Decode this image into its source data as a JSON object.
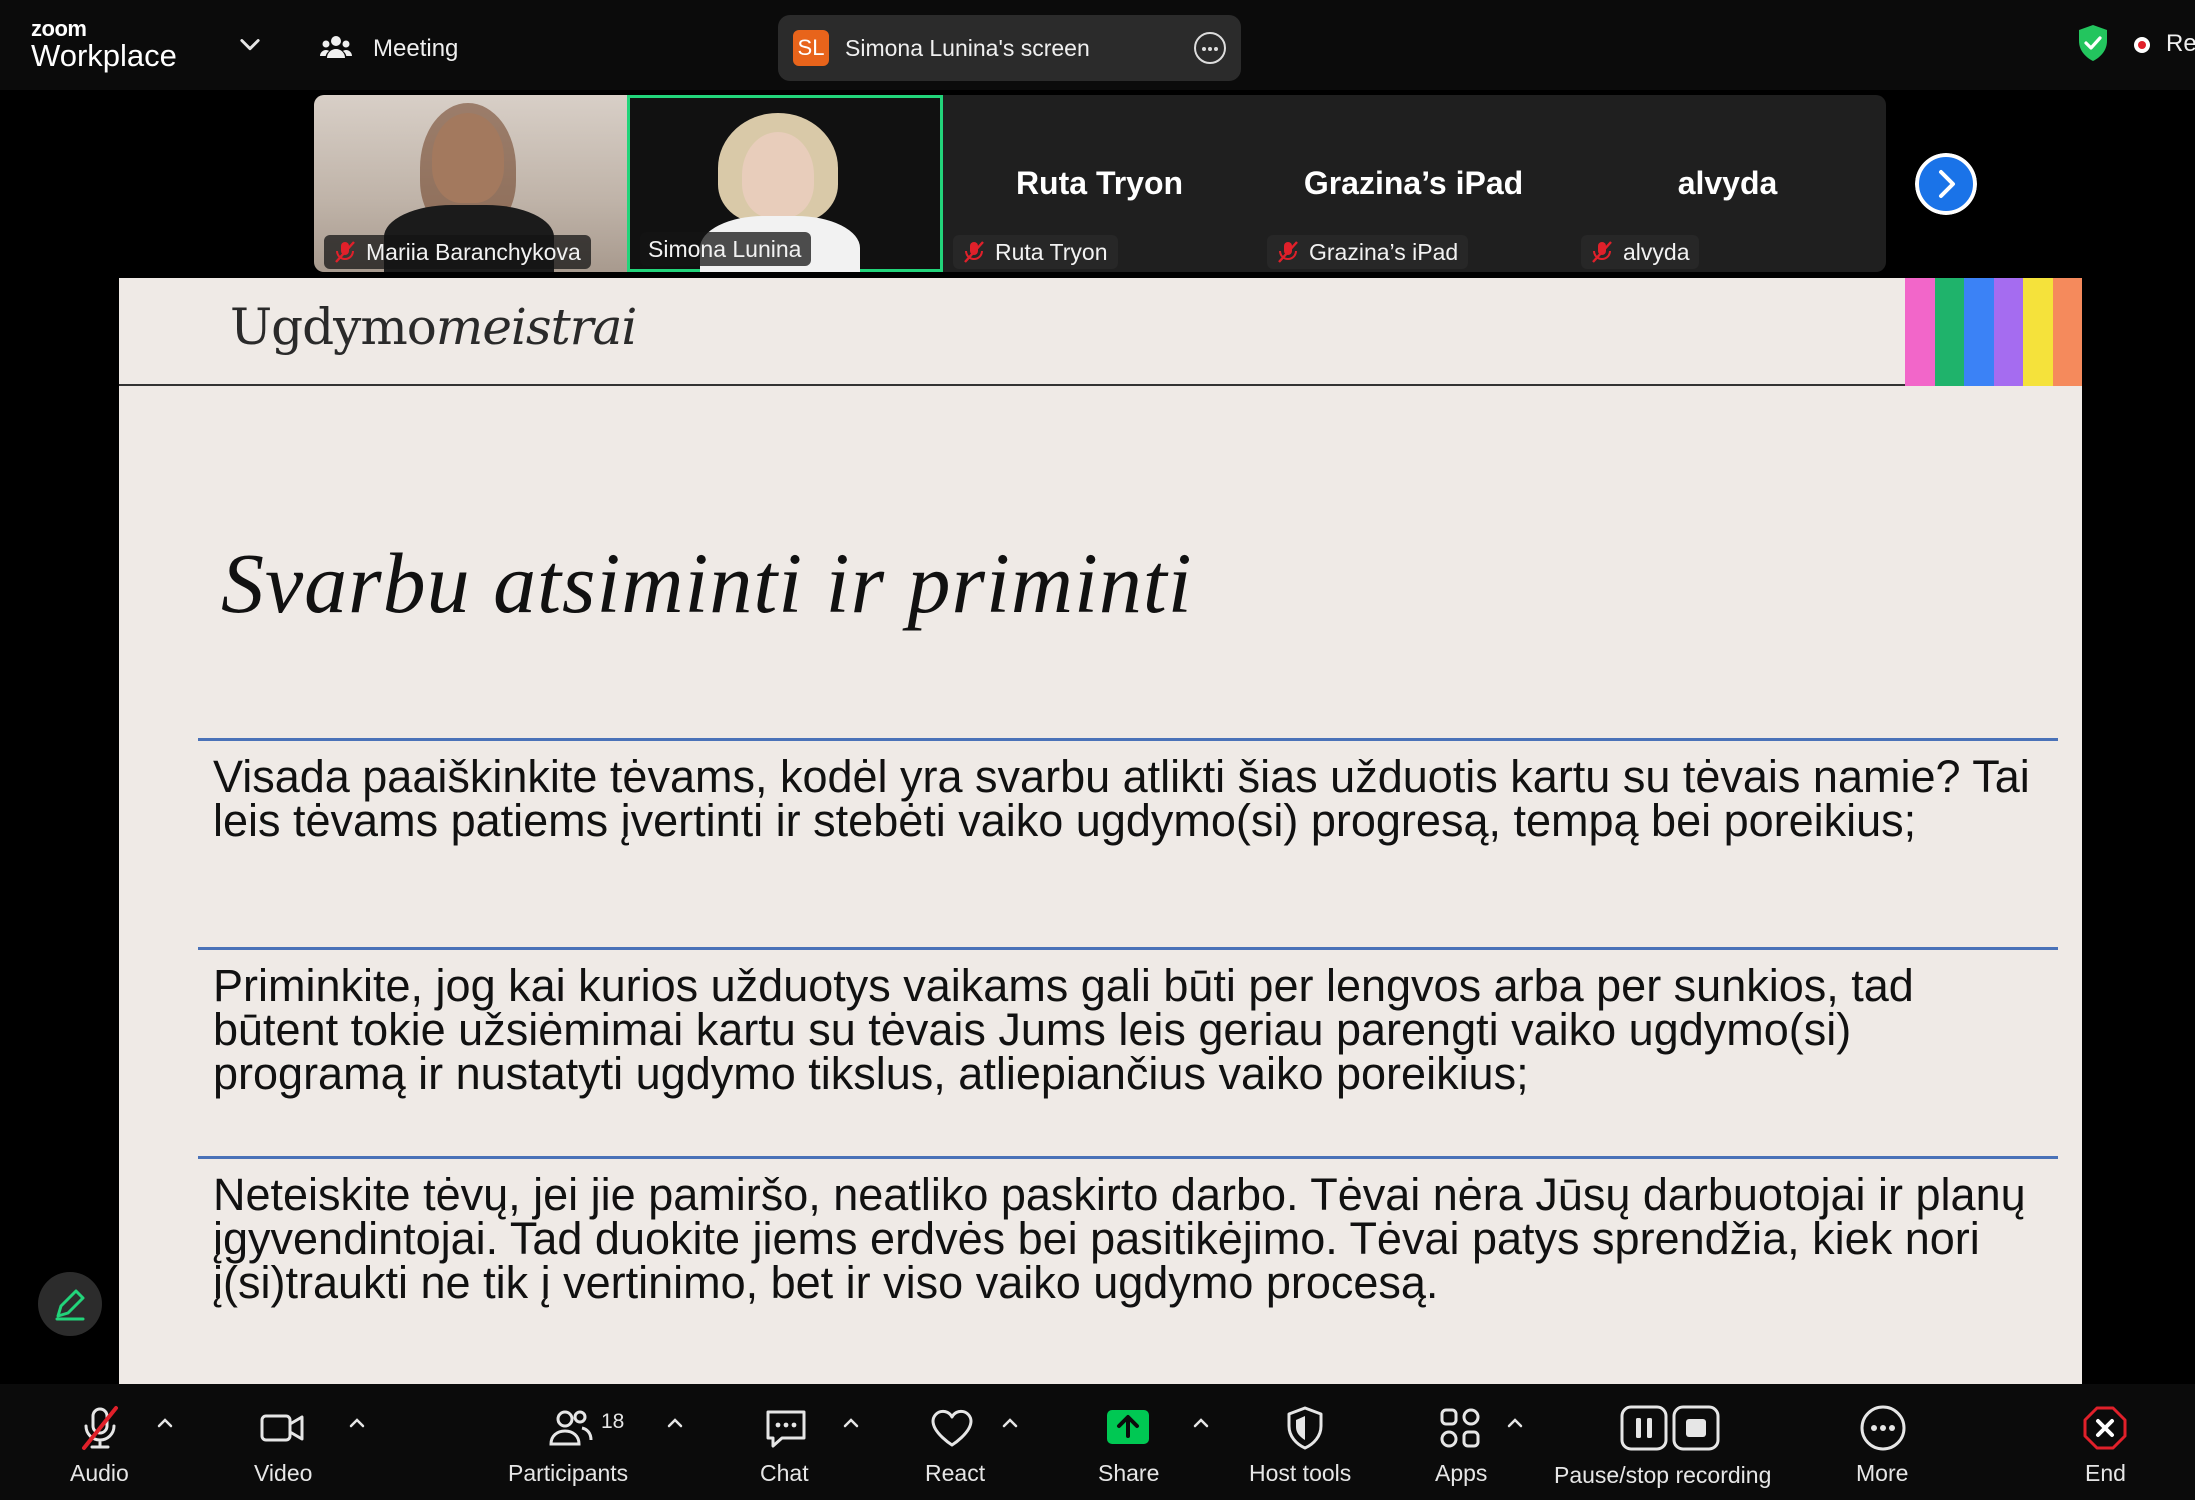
{
  "topbar": {
    "logo_small": "zoom",
    "logo_big": "Workplace",
    "meeting_label": "Meeting",
    "share_badge": "SL",
    "share_text": "Simona Lunina's screen",
    "recording_label": "Recording"
  },
  "gallery": {
    "tiles": [
      {
        "name": "Mariia Baranchykova",
        "muted": true
      },
      {
        "name": "Simona Lunina",
        "muted": false
      },
      {
        "name": "Ruta Tryon",
        "display": "Ruta Tryon",
        "muted": true
      },
      {
        "name": "Grazina’s iPad",
        "display": "Grazina’s iPad",
        "muted": true
      },
      {
        "name": "alvyda",
        "display": "alvyda",
        "muted": true
      }
    ]
  },
  "slide": {
    "brand_regular": "Ugdymo",
    "brand_italic": "meistrai",
    "title": "Svarbu atsiminti ir priminti",
    "paragraphs": [
      "Visada paaiškinkite tėvams, kodėl yra svarbu atlikti šias užduotis kartu su  tėvais namie? Tai leis tėvams patiems įvertinti ir stebėti vaiko ugdymo(si) progresą, tempą bei poreikius;",
      "Priminkite, jog kai kurios užduotys vaikams gali būti per lengvos arba per sunkios, tad būtent tokie užsiėmimai kartu su tėvais Jums leis geriau parengti vaiko ugdymo(si) programą ir nustatyti ugdymo tikslus, atliepiančius vaiko poreikius;",
      "Neteiskite tėvų, jei jie pamiršo, neatliko paskirto darbo. Tėvai nėra Jūsų darbuotojai ir planų įgyvendintojai. Tad duokite jiems erdvės bei pasitikėjimo. Tėvai patys sprendžia, kiek nori į(si)traukti ne tik į vertinimo, bet ir viso vaiko ugdymo procesą."
    ],
    "rainbow_colors": [
      "#f266c9",
      "#1fb36b",
      "#3b82f6",
      "#a56cf0",
      "#f5e23b",
      "#f58a5c"
    ]
  },
  "toolbar": {
    "audio": "Audio",
    "video": "Video",
    "participants": "Participants",
    "participants_count": "18",
    "chat": "Chat",
    "react": "React",
    "share": "Share",
    "host_tools": "Host tools",
    "apps": "Apps",
    "recording": "Pause/stop recording",
    "more": "More",
    "end": "End"
  },
  "colors": {
    "accent_green": "#22d47a",
    "share_green": "#00c853",
    "end_red": "#e0202a",
    "blue": "#1a73e8"
  }
}
